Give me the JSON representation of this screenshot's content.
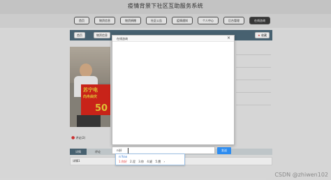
{
  "header": {
    "title": "疫情背景下社区互助服务系统"
  },
  "nav": {
    "items": [
      {
        "label": "首页"
      },
      {
        "label": "物资信息"
      },
      {
        "label": "物资捐赠"
      },
      {
        "label": "社区公告"
      },
      {
        "label": "疫情通知"
      },
      {
        "label": "个人中心"
      },
      {
        "label": "后台管理"
      },
      {
        "label": "在线咨询"
      }
    ]
  },
  "breadcrumb": {
    "home": "首页",
    "current": "物资信息"
  },
  "fav_button": "收藏",
  "comment_header": "评论(2)",
  "tabs": [
    {
      "label": "详情"
    },
    {
      "label": "评论"
    }
  ],
  "row_text": "详情1",
  "modal": {
    "title": "在线咨询",
    "close": "×"
  },
  "chat_input": {
    "value": "ni好"
  },
  "send_button": "发送",
  "ime": {
    "composition": "ni'hao",
    "candidates": [
      "1.你好",
      "2.泥",
      "3.你",
      "4.妮",
      "5.霓"
    ]
  },
  "watermark": "CSDN @zhiwen102",
  "photo_banner": {
    "line1": "苏宁电",
    "line2": "向舟曲灾",
    "amount": "50"
  }
}
